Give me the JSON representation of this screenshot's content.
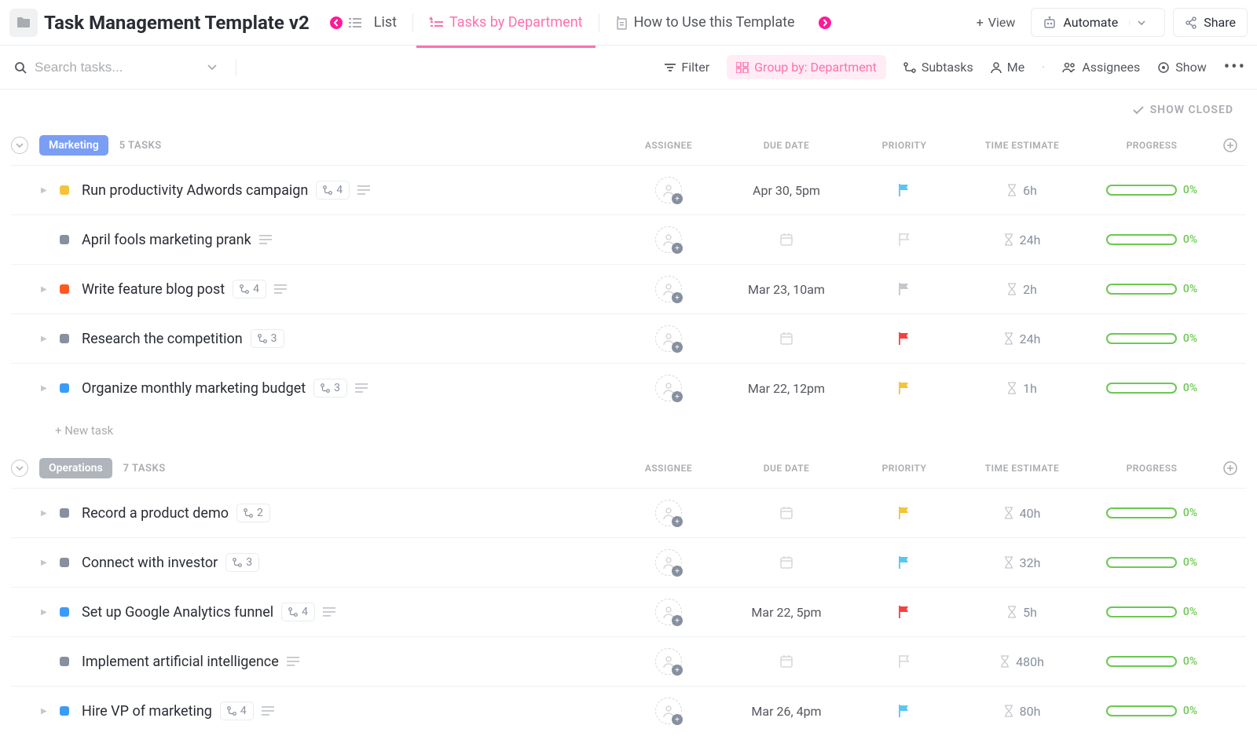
{
  "header": {
    "title": "Task Management Template v2",
    "tabs": [
      {
        "label": "List",
        "icon": "list-icon"
      },
      {
        "label": "Tasks by Department",
        "icon": "list-icon"
      },
      {
        "label": "How to Use this Template",
        "icon": "doc-icon"
      }
    ],
    "view_label": "View",
    "automate_label": "Automate",
    "share_label": "Share"
  },
  "toolbar": {
    "search_placeholder": "Search tasks...",
    "filter_label": "Filter",
    "group_label": "Group by: Department",
    "subtasks_label": "Subtasks",
    "me_label": "Me",
    "assignees_label": "Assignees",
    "show_label": "Show"
  },
  "show_closed_label": "SHOW CLOSED",
  "columns": {
    "assignee": "ASSIGNEE",
    "due_date": "DUE DATE",
    "priority": "PRIORITY",
    "time_estimate": "TIME ESTIMATE",
    "progress": "PROGRESS"
  },
  "groups": [
    {
      "name": "Marketing",
      "color": "#7b9ef5",
      "count_label": "5 TASKS",
      "tasks": [
        {
          "status_color": "#f5c33b",
          "has_caret": true,
          "name": "Run productivity Adwords campaign",
          "subtasks": "4",
          "has_desc": true,
          "due": "Apr 30, 5pm",
          "priority_color": "#5bc5f2",
          "estimate": "6h",
          "progress": "0%"
        },
        {
          "status_color": "#87909e",
          "has_caret": false,
          "name": "April fools marketing prank",
          "subtasks": "",
          "has_desc": true,
          "due": "",
          "priority_color": "",
          "estimate": "24h",
          "progress": "0%"
        },
        {
          "status_color": "#ff5722",
          "has_caret": true,
          "name": "Write feature blog post",
          "subtasks": "4",
          "has_desc": true,
          "due": "Mar 23, 10am",
          "priority_color": "#c4c7cc",
          "estimate": "2h",
          "progress": "0%"
        },
        {
          "status_color": "#87909e",
          "has_caret": true,
          "name": "Research the competition",
          "subtasks": "3",
          "has_desc": false,
          "due": "",
          "priority_color": "#f63f3f",
          "estimate": "24h",
          "progress": "0%"
        },
        {
          "status_color": "#3b9cf7",
          "has_caret": true,
          "name": "Organize monthly marketing budget",
          "subtasks": "3",
          "has_desc": true,
          "due": "Mar 22, 12pm",
          "priority_color": "#f5c33b",
          "estimate": "1h",
          "progress": "0%"
        }
      ],
      "new_task_label": "+ New task"
    },
    {
      "name": "Operations",
      "color": "#b0b4bb",
      "count_label": "7 TASKS",
      "tasks": [
        {
          "status_color": "#87909e",
          "has_caret": true,
          "name": "Record a product demo",
          "subtasks": "2",
          "has_desc": false,
          "due": "",
          "priority_color": "#f5c33b",
          "estimate": "40h",
          "progress": "0%"
        },
        {
          "status_color": "#87909e",
          "has_caret": true,
          "name": "Connect with investor",
          "subtasks": "3",
          "has_desc": false,
          "due": "",
          "priority_color": "#5bc5f2",
          "estimate": "32h",
          "progress": "0%"
        },
        {
          "status_color": "#3b9cf7",
          "has_caret": true,
          "name": "Set up Google Analytics funnel",
          "subtasks": "4",
          "has_desc": true,
          "due": "Mar 22, 5pm",
          "priority_color": "#f63f3f",
          "estimate": "5h",
          "progress": "0%"
        },
        {
          "status_color": "#87909e",
          "has_caret": false,
          "name": "Implement artificial intelligence",
          "subtasks": "",
          "has_desc": true,
          "due": "",
          "priority_color": "",
          "estimate": "480h",
          "progress": "0%"
        },
        {
          "status_color": "#3b9cf7",
          "has_caret": true,
          "name": "Hire VP of marketing",
          "subtasks": "4",
          "has_desc": true,
          "due": "Mar 26, 4pm",
          "priority_color": "#5bc5f2",
          "estimate": "80h",
          "progress": "0%"
        }
      ]
    }
  ]
}
